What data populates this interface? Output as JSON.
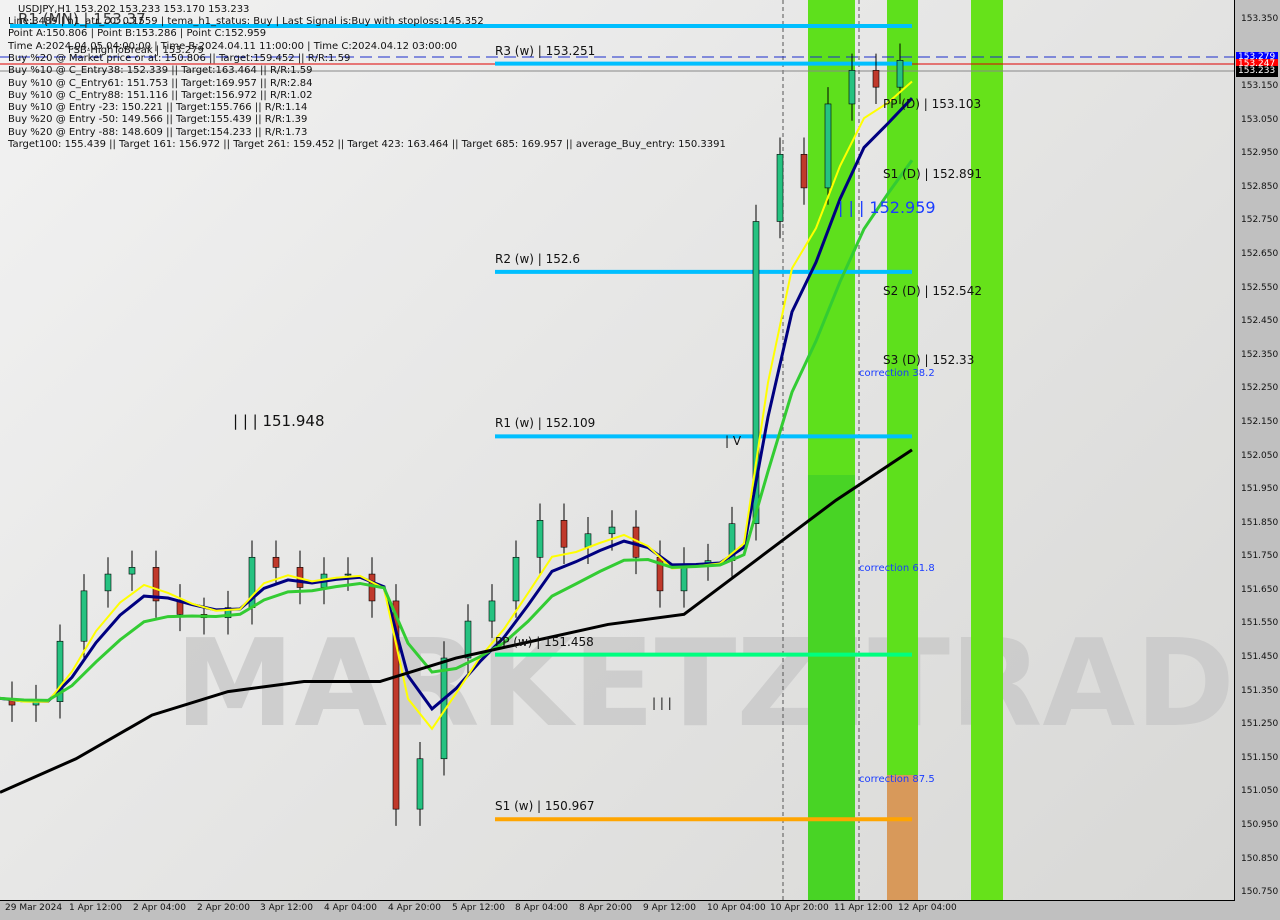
{
  "header": {
    "title": "USDJPY,H1  153.202 153.233 153.170 153.233",
    "lines": [
      "Line:3489 | h1_atr_c0: 0.1559 | tema_h1_status: Buy | Last Signal is:Buy with stoploss:145.352",
      "Point A:150.806 | Point B:153.286 | Point C:152.959",
      "Time A:2024.04.05 04:00:00 | Time B:2024.04.11 11:00:00 | Time C:2024.04.12 03:00:00",
      "Buy %20 @ Market price or at: 150.806 || Target:159.452 || R/R:1.59",
      "Buy %10 @ C_Entry38: 152.339 || Target:163.464 || R/R:1.59",
      "Buy %10 @ C_Entry61: 151.753 || Target:169.957 || R/R:2.84",
      "Buy %10 @ C_Entry88: 151.116 || Target:156.972 || R/R:1.02",
      "Buy %10 @ Entry -23: 150.221 || Target:155.766 || R/R:1.14",
      "Buy %20 @ Entry -50: 149.566 || Target:155.439 || R/R:1.39",
      "Buy %20 @ Entry -88: 148.609 || Target:154.233 || R/R:1.73",
      "Target100: 155.439 || Target 161: 156.972 || Target 261: 159.452 || Target 423: 163.464 || Target 685: 169.957 || average_Buy_entry: 150.3391"
    ]
  },
  "chart_data": {
    "type": "candlestick",
    "symbol": "USDJPY",
    "timeframe": "H1",
    "ylim": [
      150.72,
      153.4
    ],
    "y_ticks": [
      "153.350",
      "153.150",
      "153.050",
      "152.950",
      "152.850",
      "152.750",
      "152.650",
      "152.550",
      "152.450",
      "152.350",
      "152.250",
      "152.150",
      "152.050",
      "151.950",
      "151.850",
      "151.750",
      "151.650",
      "151.550",
      "151.450",
      "151.350",
      "151.250",
      "151.150",
      "151.050",
      "150.950",
      "150.850",
      "150.750"
    ],
    "x_ticks": [
      "29 Mar 2024",
      "1 Apr 12:00",
      "2 Apr 04:00",
      "2 Apr 20:00",
      "3 Apr 12:00",
      "4 Apr 04:00",
      "4 Apr 20:00",
      "5 Apr 12:00",
      "8 Apr 04:00",
      "8 Apr 20:00",
      "9 Apr 12:00",
      "10 Apr 04:00",
      "10 Apr 20:00",
      "11 Apr 12:00",
      "12 Apr 04:00"
    ],
    "close_approx": [
      151.33,
      151.31,
      151.32,
      151.5,
      151.65,
      151.7,
      151.72,
      151.62,
      151.58,
      151.57,
      151.6,
      151.75,
      151.72,
      151.66,
      151.7,
      151.7,
      151.62,
      151.0,
      151.15,
      151.45,
      151.56,
      151.62,
      151.75,
      151.86,
      151.78,
      151.82,
      151.84,
      151.75,
      151.65,
      151.73,
      151.74,
      151.85,
      152.75,
      152.95,
      152.85,
      153.1,
      153.2,
      153.15,
      153.23
    ],
    "ma_black_approx": [
      151.05,
      151.15,
      151.28,
      151.35,
      151.38,
      151.38,
      151.45,
      151.5,
      151.55,
      151.58,
      151.75,
      151.92,
      152.07
    ],
    "price_tags": [
      {
        "value": "153.279",
        "color": "#0000ff"
      },
      {
        "value": "153.247",
        "color": "#ff0000"
      },
      {
        "value": "153.233",
        "color": "#000000"
      }
    ],
    "levels": [
      {
        "label": "R3 (w) | 153.251",
        "value": 153.22,
        "color": "#00bfff"
      },
      {
        "label": "R2 (w) | 152.6",
        "value": 152.6,
        "color": "#00bfff"
      },
      {
        "label": "R1 (w) | 152.109",
        "value": 152.11,
        "color": "#00bfff"
      },
      {
        "label": "PP (w) | 151.458",
        "value": 151.46,
        "color": "#00ff7f"
      },
      {
        "label": "S1 (w) | 150.967",
        "value": 150.97,
        "color": "#ffa500"
      }
    ],
    "daily_levels": [
      "PP (D) | 153.103",
      "S1 (D) | 152.891",
      "S2 (D) | 152.542",
      "S3 (D) | 152.33"
    ],
    "annotations": {
      "r1mn": "R1 (MN) | 153.37",
      "fsb": "FSB-HighToBreak | 153.279",
      "a": "| | | 151.948",
      "b": "| V",
      "c": "| | |",
      "d": "| | | 152.959",
      "c382": "correction 38.2",
      "c618": "correction 61.8",
      "c875": "correction 87.5"
    },
    "watermark": "MARKETZITRADE"
  }
}
